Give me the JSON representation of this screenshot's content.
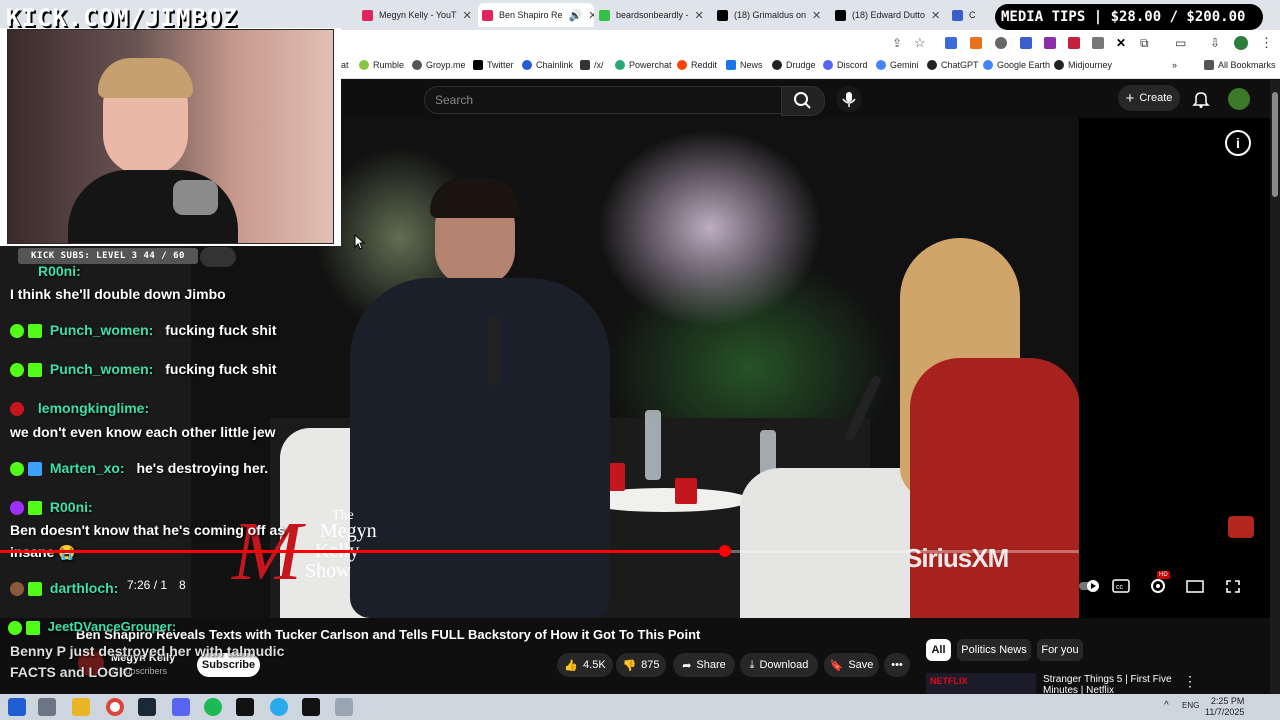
{
  "overlay": {
    "kick_url": "KICK.COM/JIMBOZ",
    "media_tips": "MEDIA TIPS | $28.00 / $200.00",
    "kick_subs": "KICK SUBS: LEVEL 3 44 / 60"
  },
  "tabs": [
    {
      "label": "Megyn Kelly - YouT",
      "color": "#e0245e"
    },
    {
      "label": "Ben Shapiro Re",
      "color": "#e0245e",
      "active": true
    },
    {
      "label": "beardsonbeardly -",
      "color": "#35c04a"
    },
    {
      "label": "(18) Grimaldus on",
      "color": "#000000"
    },
    {
      "label": "(18) Edward Dutto",
      "color": "#000000"
    },
    {
      "label": "C",
      "color": "#3a5fcd"
    }
  ],
  "bookmarks": [
    {
      "label": "at",
      "color": "#ffffff"
    },
    {
      "label": "Rumble",
      "color": "#85c742"
    },
    {
      "label": "Groyp.me",
      "color": "#555555"
    },
    {
      "label": "Twitter",
      "color": "#000000"
    },
    {
      "label": "Chainlink",
      "color": "#2a5ada"
    },
    {
      "label": "/x/",
      "color": "#333333"
    },
    {
      "label": "Powerchat",
      "color": "#2aa876"
    },
    {
      "label": "Reddit",
      "color": "#ff4500"
    },
    {
      "label": "News",
      "color": "#1a73e8"
    },
    {
      "label": "Drudge",
      "color": "#222222"
    },
    {
      "label": "Discord",
      "color": "#5865f2"
    },
    {
      "label": "Gemini",
      "color": "#4285f4"
    },
    {
      "label": "ChatGPT",
      "color": "#222222"
    },
    {
      "label": "Google Earth",
      "color": "#4285f4"
    },
    {
      "label": "Midjourney",
      "color": "#222222"
    },
    {
      "label": "All Bookmarks",
      "color": "#555555"
    }
  ],
  "youtube": {
    "search_placeholder": "Search",
    "create_label": "Create",
    "time": "7:26 / 1",
    "time_tail": "8",
    "sirius": "SiriusXM",
    "show_logo": [
      "The",
      "Megyn",
      "Kelly",
      "Show"
    ],
    "title": "Ben Shapiro Reveals Texts with Tucker Carlson and Tells FULL Backstory of How it Got To This Point",
    "channel": "Megyn Kelly",
    "subscribers": "M subscribers",
    "subscribe": "Subscribe",
    "likes": "4.5K",
    "dislikes": "875",
    "share": "Share",
    "download": "Download",
    "save": "Save",
    "chips": [
      "All",
      "Politics News",
      "For you"
    ],
    "rec_title": "Stranger Things 5 | First Five Minutes | Netflix",
    "rec_badge": "NETFLIX",
    "hd_badge": "HD",
    "progress_fraction": 0.6
  },
  "chat": [
    {
      "user": "R00ni:",
      "text": "I think she'll double down Jimbo"
    },
    {
      "user": "Punch_women:",
      "text": "fucking fuck shit"
    },
    {
      "user": "Punch_women:",
      "text": "fucking fuck shit"
    },
    {
      "user": "lemongkinglime:",
      "text": "we don't even know each other little jew"
    },
    {
      "user": "Marten_xo:",
      "text": "he's destroying her."
    },
    {
      "user": "R00ni:",
      "text": "Ben doesn't know that he's coming off as"
    },
    {
      "user": "",
      "text": "insane 😭"
    },
    {
      "user": "darthloch:",
      "text": ""
    },
    {
      "user": "JeetDVanceGrouper:",
      "text": ""
    },
    {
      "user": "",
      "text": "Benny P just destroyed her with talmudic"
    },
    {
      "user": "",
      "text": "FACTS and LOGIC"
    }
  ],
  "taskbar": {
    "lang": "ENG",
    "time": "2:25 PM",
    "date": "11/7/2025"
  },
  "colors": {
    "accent_red": "#ff0000",
    "kick_green": "#53fc18",
    "chat_user": "#3ce0a8"
  }
}
